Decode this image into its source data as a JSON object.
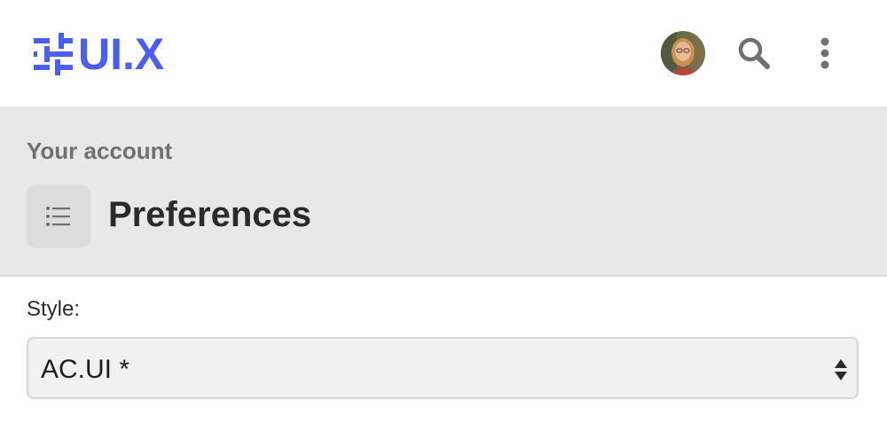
{
  "app": {
    "logo_text": "UI.X",
    "brand_color": "#4a5ff0"
  },
  "topbar": {
    "avatar_icon": "user-avatar",
    "search_icon": "search-icon",
    "more_icon": "more-vertical-icon"
  },
  "header": {
    "breadcrumb": "Your account",
    "title": "Preferences",
    "title_icon": "list-icon"
  },
  "form": {
    "style_label": "Style:",
    "style_value": "AC.UI *"
  }
}
